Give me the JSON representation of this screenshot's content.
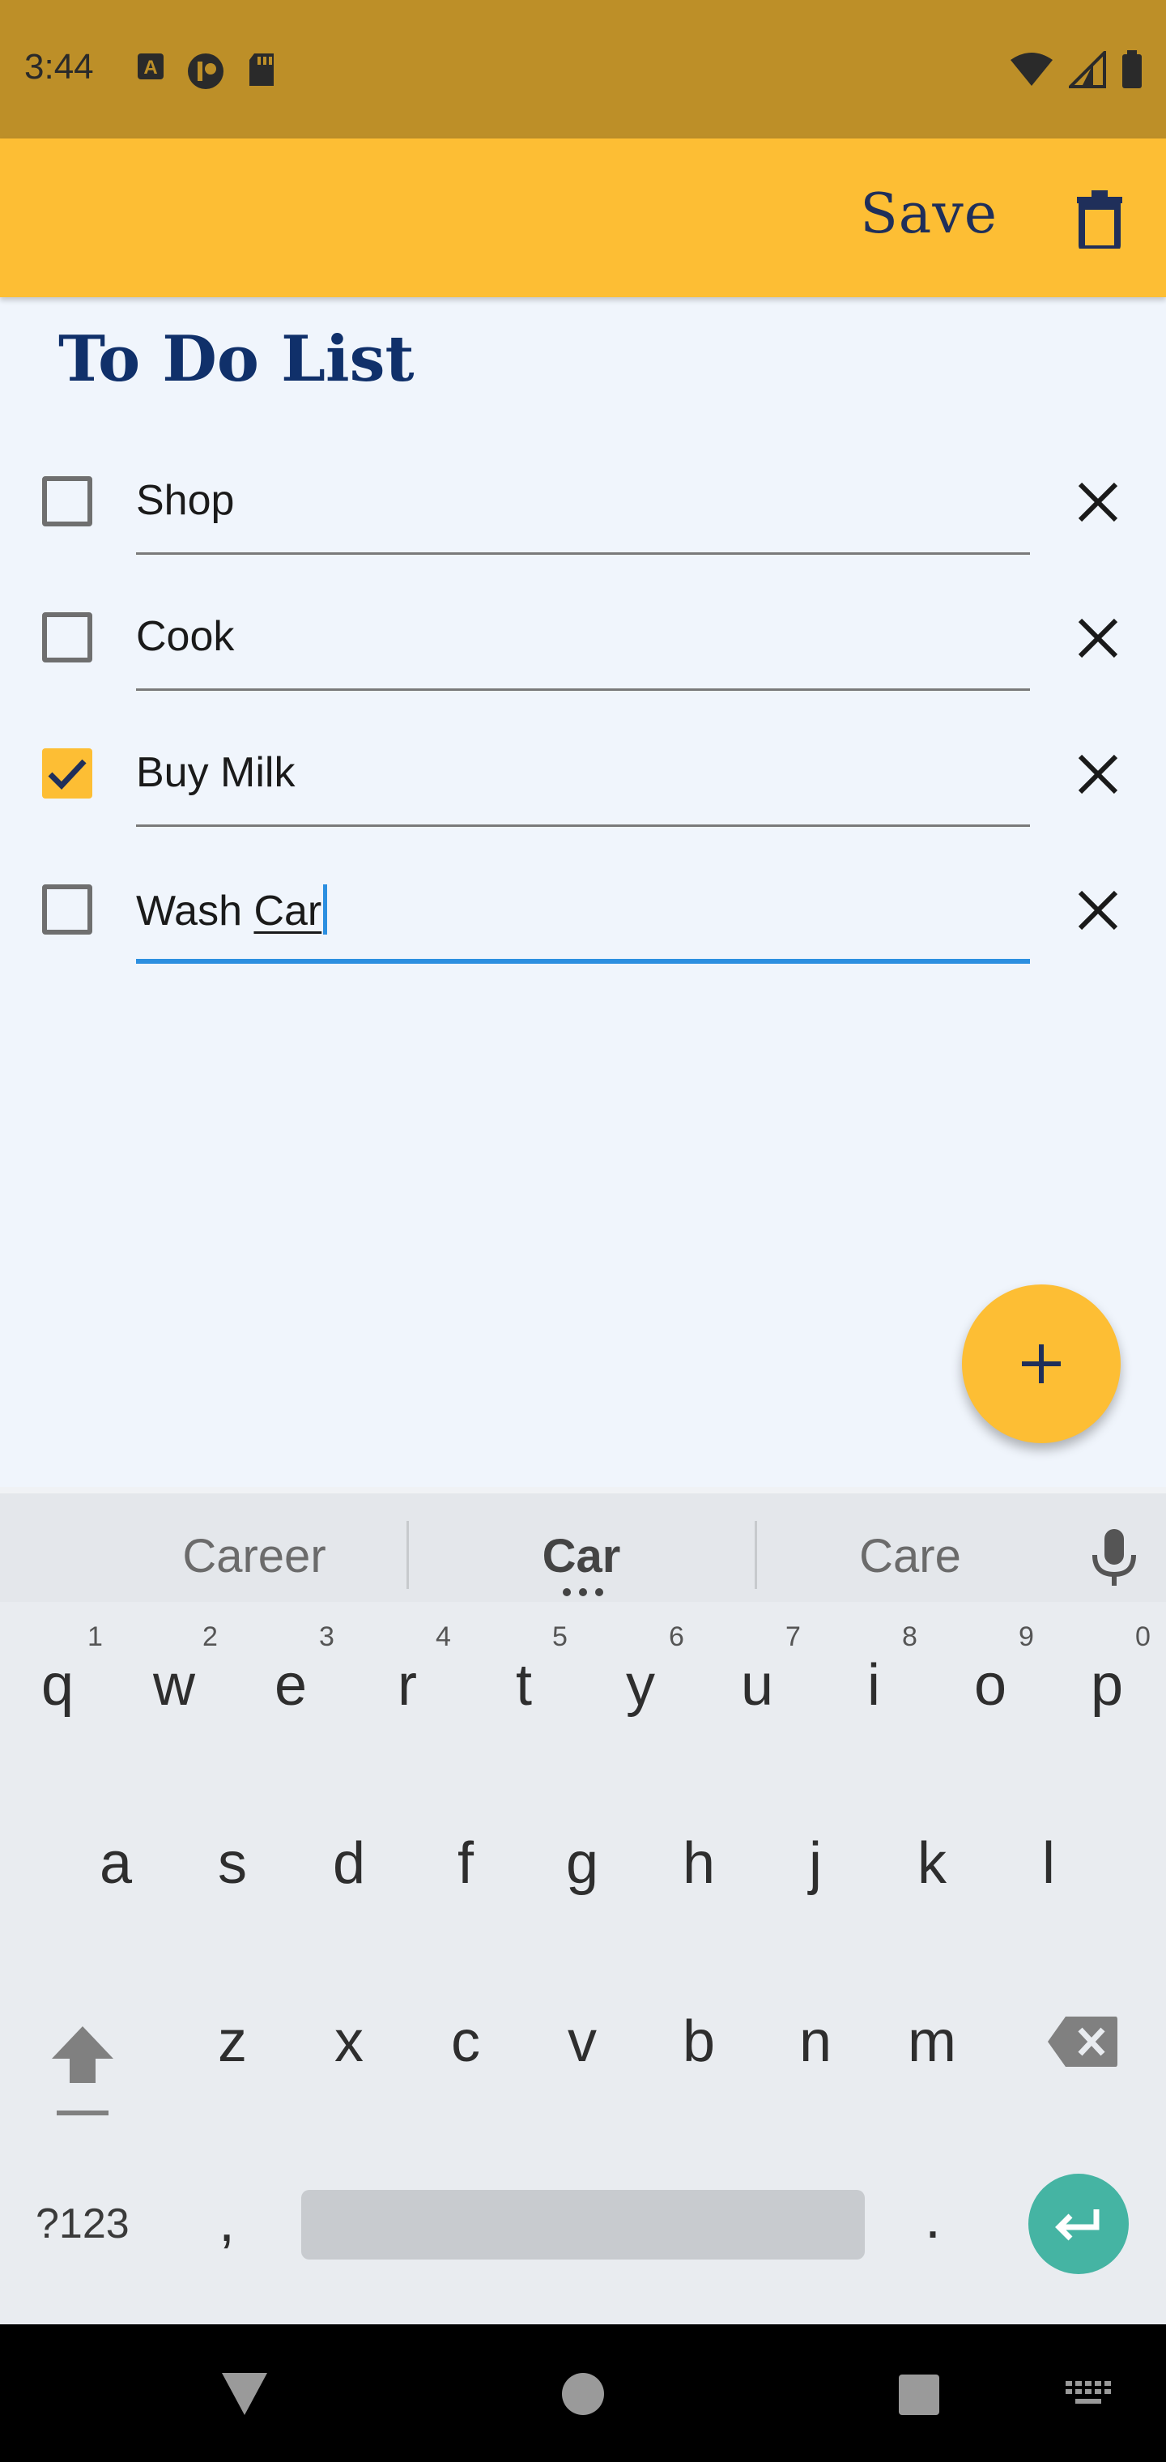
{
  "status_bar": {
    "time": "3:44",
    "left_icons": [
      "a-icon",
      "account-icon",
      "sd-card-icon"
    ],
    "right_icons": [
      "wifi-icon",
      "signal-icon",
      "battery-icon"
    ]
  },
  "app_bar": {
    "save_label": "Save",
    "delete_icon": "trash-icon"
  },
  "page": {
    "title": "To Do List"
  },
  "todos": [
    {
      "text": "Shop",
      "checked": false
    },
    {
      "text": "Cook",
      "checked": false
    },
    {
      "text": "Buy Milk",
      "checked": true
    },
    {
      "text_prefix": "Wash ",
      "text_underlined": "Car",
      "checked": false,
      "focused": true
    }
  ],
  "fab": {
    "icon": "plus-icon"
  },
  "keyboard": {
    "suggestions": [
      "Career",
      "Car",
      "Care"
    ],
    "row1": [
      "q",
      "w",
      "e",
      "r",
      "t",
      "y",
      "u",
      "i",
      "o",
      "p"
    ],
    "row1_numbers": [
      "1",
      "2",
      "3",
      "4",
      "5",
      "6",
      "7",
      "8",
      "9",
      "0"
    ],
    "row2": [
      "a",
      "s",
      "d",
      "f",
      "g",
      "h",
      "j",
      "k",
      "l"
    ],
    "row3": [
      "z",
      "x",
      "c",
      "v",
      "b",
      "n",
      "m"
    ],
    "symbols_label": "?123",
    "comma": ",",
    "period": "."
  },
  "colors": {
    "status_bar": "#bd8f28",
    "accent": "#fdbe34",
    "title": "#10306a",
    "focus": "#2c8fe0",
    "enter": "#45b4a3"
  }
}
